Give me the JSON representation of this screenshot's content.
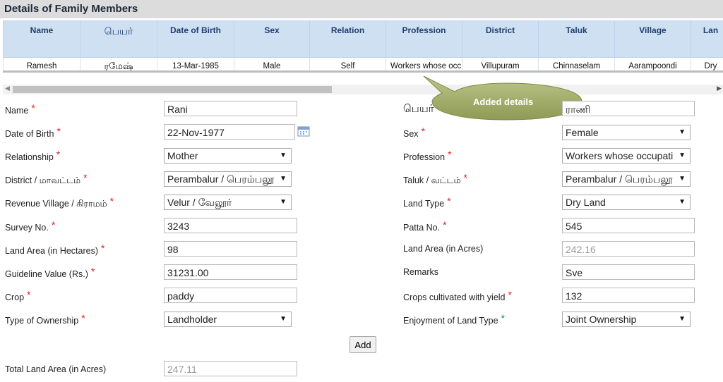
{
  "title": "Details of Family Members",
  "table": {
    "headers": [
      "Name",
      "பெயர்",
      "Date of Birth",
      "Sex",
      "Relation",
      "Profession",
      "District",
      "Taluk",
      "Village",
      "Lan"
    ],
    "rows": [
      [
        "Ramesh",
        "ரமேஷ்",
        "13-Mar-1985",
        "Male",
        "Self",
        "Workers whose occ",
        "Villupuram",
        "Chinnaselam",
        "Aarampoondi",
        "Dry"
      ]
    ]
  },
  "callout": "Added details",
  "form": {
    "name": {
      "label": "Name",
      "value": "Rani"
    },
    "tamil_name": {
      "label": "பெயர்",
      "value": "ராணி"
    },
    "dob": {
      "label": "Date of Birth",
      "value": "22-Nov-1977"
    },
    "sex": {
      "label": "Sex",
      "value": "Female"
    },
    "relationship": {
      "label": "Relationship",
      "value": "Mother"
    },
    "profession": {
      "label": "Profession",
      "value": "Workers whose occupati"
    },
    "district": {
      "label": "District / மாவட்டம்",
      "value": "Perambalur / பெரம்பலூ"
    },
    "taluk": {
      "label": "Taluk / வட்டம்",
      "value": "Perambalur / பெரம்பலூ"
    },
    "village": {
      "label": "Revenue Village / கிராமம்",
      "value": "Velur / வேலூர்"
    },
    "land_type": {
      "label": "Land Type",
      "value": "Dry Land"
    },
    "survey_no": {
      "label": "Survey No.",
      "value": "3243"
    },
    "patta_no": {
      "label": "Patta No.",
      "value": "545"
    },
    "land_area_hectares": {
      "label": "Land Area (in Hectares)",
      "value": "98"
    },
    "land_area_acres": {
      "label": "Land Area (in Acres)",
      "value": "242.16"
    },
    "guideline_value": {
      "label": "Guideline Value (Rs.)",
      "value": "31231.00"
    },
    "remarks": {
      "label": "Remarks",
      "value": "Sve"
    },
    "crop": {
      "label": "Crop",
      "value": "paddy"
    },
    "crops_yield": {
      "label": "Crops cultivated with yield",
      "value": "132"
    },
    "ownership_type": {
      "label": "Type of Ownership",
      "value": "Landholder"
    },
    "enjoyment": {
      "label": "Enjoyment of Land Type",
      "value": "Joint Ownership"
    },
    "add_label": "Add",
    "total_land_area": {
      "label": "Total Land Area (in Acres)",
      "value": "247.11"
    }
  }
}
